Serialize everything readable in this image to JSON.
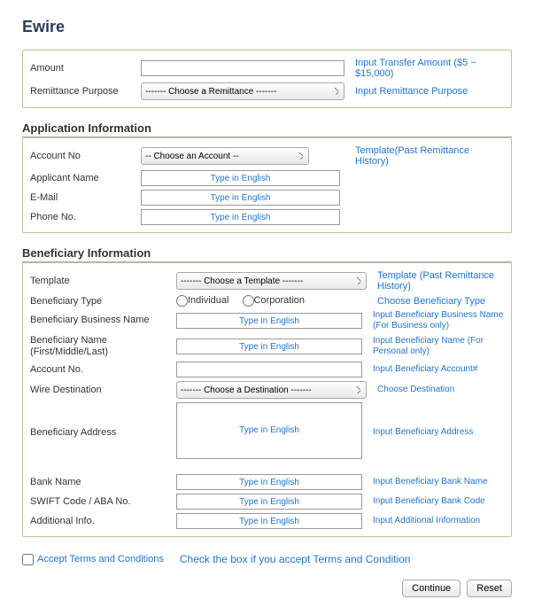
{
  "page_title": "Ewire",
  "amount": {
    "label": "Amount",
    "value": "",
    "hint": "Input Transfer Amount ($5 ~ $15,000)"
  },
  "remittance_purpose": {
    "label": "Remittance Purpose",
    "selected": "------- Choose a Remittance -------",
    "hint": "Input Remittance Purpose"
  },
  "app_info_title": "Application Information",
  "app_info": {
    "account_no": {
      "label": "Account No",
      "selected": "-- Choose an Account --",
      "hint": "Template(Past Remittance History)"
    },
    "applicant_name": {
      "label": "Applicant Name",
      "placeholder": "Type in English"
    },
    "email": {
      "label": "E-Mail",
      "placeholder": "Type in English"
    },
    "phone": {
      "label": "Phone No.",
      "placeholder": "Type in English"
    }
  },
  "ben_info_title": "Beneficiary Information",
  "ben": {
    "template": {
      "label": "Template",
      "selected": "------- Choose a Template -------",
      "hint": "Template (Past Remittance History)"
    },
    "type": {
      "label": "Beneficiary Type",
      "opt1": "Individual",
      "opt2": "Corporation",
      "hint": "Choose Beneficiary Type"
    },
    "biz_name": {
      "label": "Beneficiary Business Name",
      "placeholder": "Type in English",
      "hint": "Input Beneficiary Business Name (For Business only)"
    },
    "name": {
      "label": "Beneficiary Name (First/Middle/Last)",
      "placeholder": "Type in English",
      "hint": "Input Beneficiary Name (For Personal only)"
    },
    "account_no": {
      "label": "Account No.",
      "value": "",
      "hint": "Input Beneficiary Account#"
    },
    "wire_dest": {
      "label": "Wire Destination",
      "selected": "------- Choose a Destination -------",
      "hint": "Choose Destination"
    },
    "address": {
      "label": "Beneficiary Address",
      "placeholder": "Type in English",
      "hint": "Input Beneficiary Address"
    },
    "bank_name": {
      "label": "Bank Name",
      "placeholder": "Type in English",
      "hint": "Input Beneficiary Bank Name"
    },
    "swift": {
      "label": "SWIFT Code / ABA No.",
      "placeholder": "Type in English",
      "hint": "Input Beneficiary Bank Code"
    },
    "additional": {
      "label": "Additional Info.",
      "placeholder": "Type in English",
      "hint": "Input Additional Information"
    }
  },
  "terms": {
    "label": "Accept Terms and Conditions",
    "text": "Check the box if you accept Terms and Condition"
  },
  "buttons": {
    "continue": "Continue",
    "reset": "Reset"
  }
}
